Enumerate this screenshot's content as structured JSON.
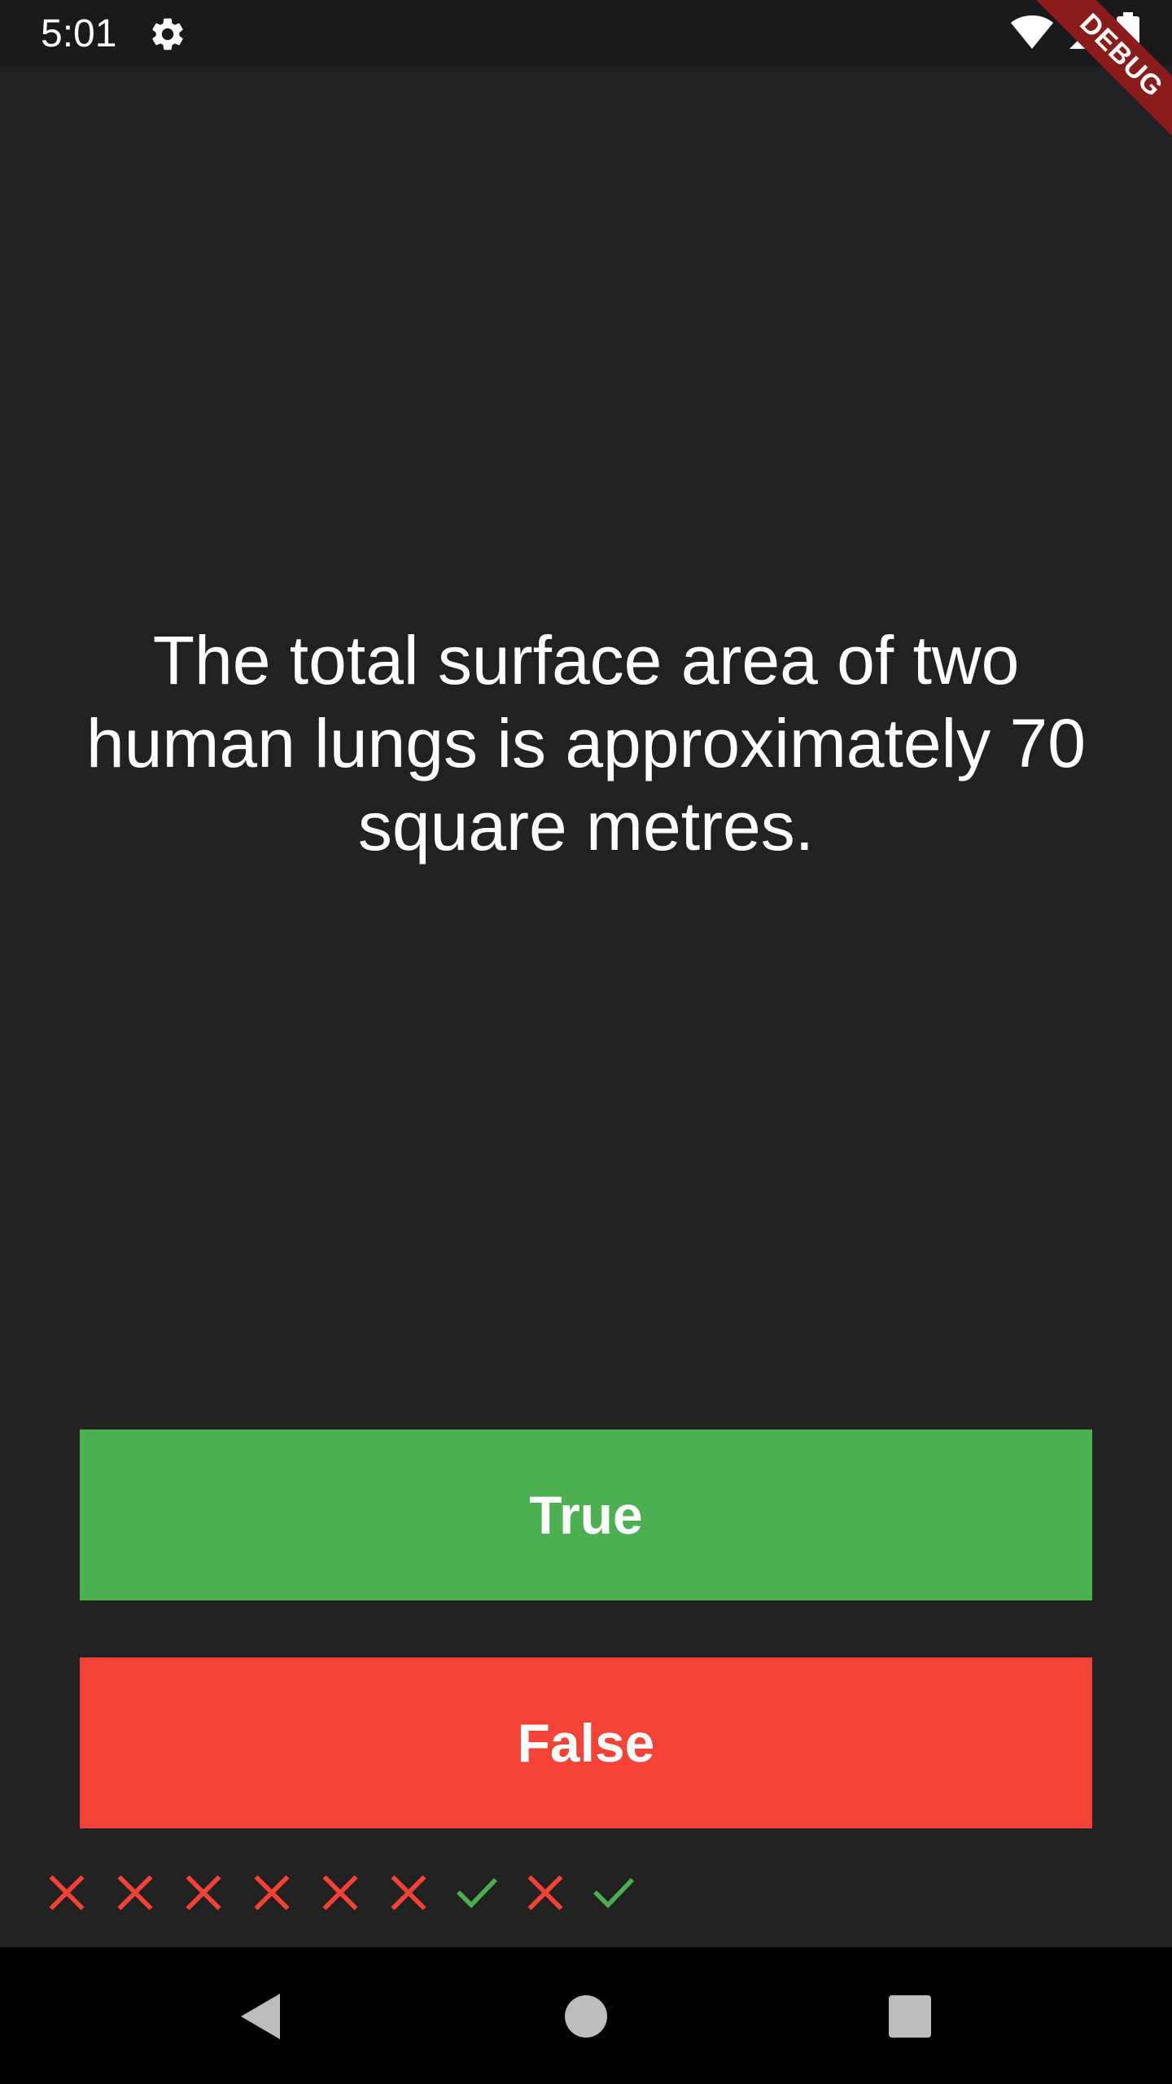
{
  "status_bar": {
    "time": "5:01",
    "icons": [
      "settings-icon",
      "wifi-icon",
      "cell-signal-icon",
      "battery-icon"
    ]
  },
  "debug_banner": {
    "label": "DEBUG"
  },
  "question": {
    "text": "The total surface area of two human lungs is approximately 70 square metres."
  },
  "buttons": {
    "true_label": "True",
    "false_label": "False"
  },
  "score": {
    "results": [
      "wrong",
      "wrong",
      "wrong",
      "wrong",
      "wrong",
      "wrong",
      "correct",
      "wrong",
      "correct"
    ]
  },
  "nav_bar": {
    "icons": [
      "back-icon",
      "home-icon",
      "recents-icon"
    ]
  },
  "colors": {
    "background": "#212121",
    "true_button": "#4caf50",
    "false_button": "#f44336",
    "correct": "#4caf50",
    "wrong": "#f44336",
    "debug_ribbon": "#8b1c1c"
  }
}
